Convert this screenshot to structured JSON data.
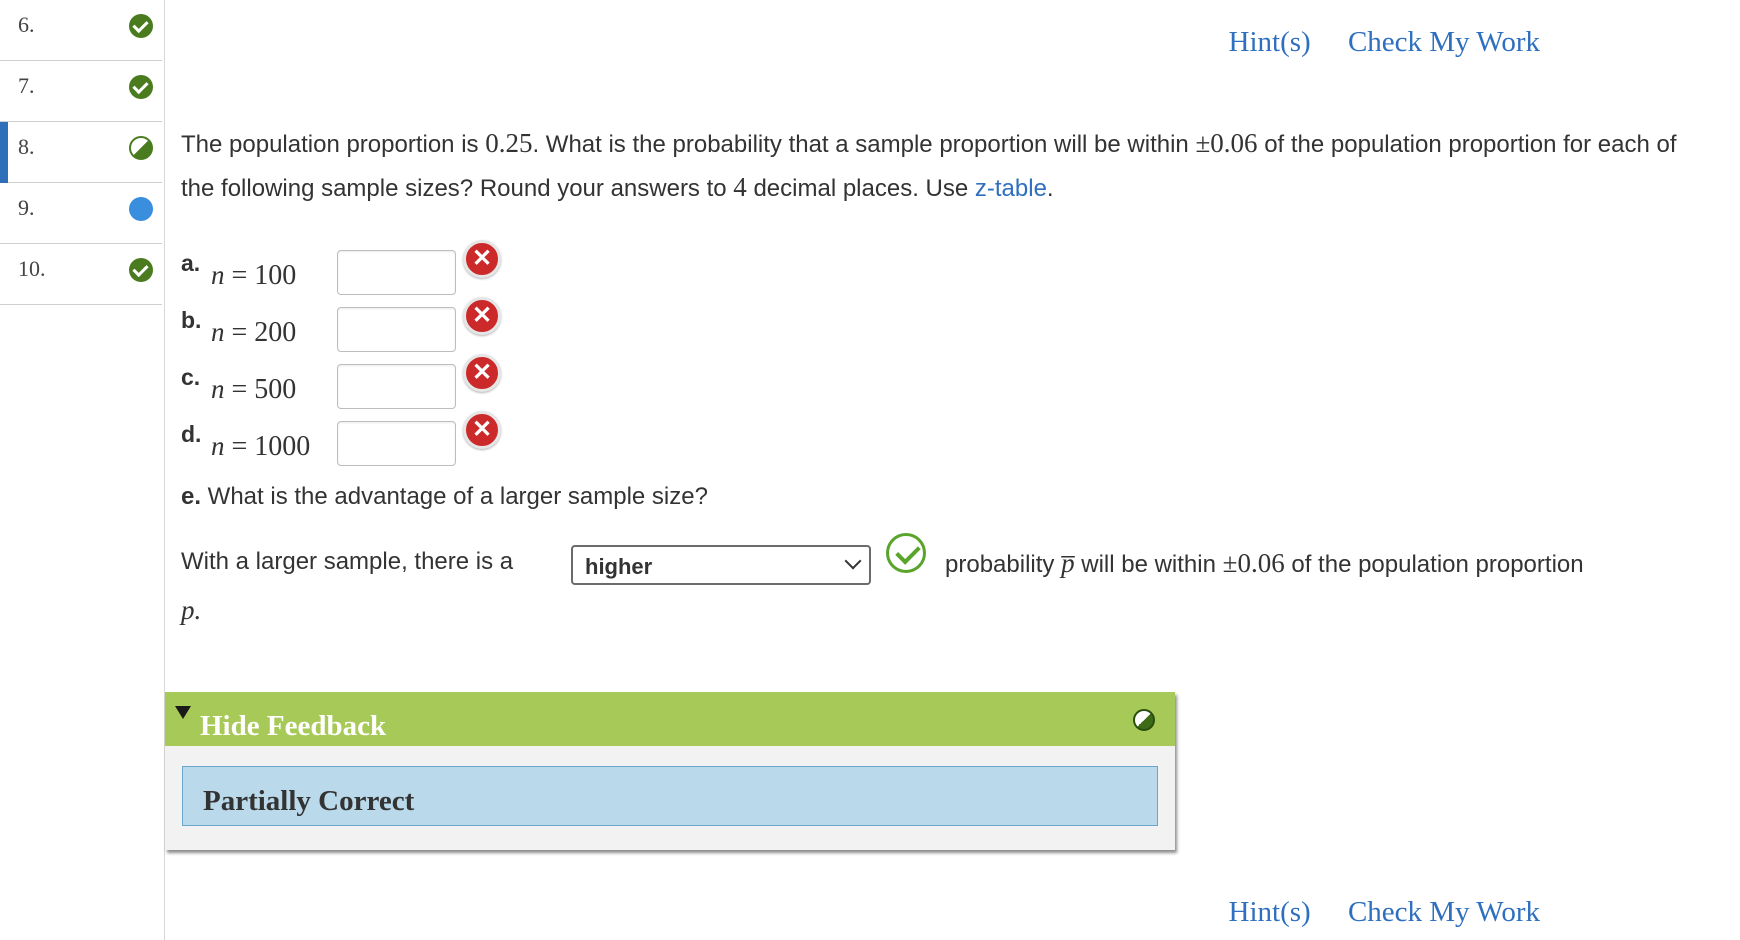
{
  "sidebar": {
    "items": [
      {
        "num": "6.",
        "status": "correct"
      },
      {
        "num": "7.",
        "status": "correct"
      },
      {
        "num": "8.",
        "status": "partial",
        "active": true
      },
      {
        "num": "9.",
        "status": "current"
      },
      {
        "num": "10.",
        "status": "correct"
      }
    ]
  },
  "links": {
    "hints": "Hint(s)",
    "check": "Check My Work"
  },
  "question": {
    "text1": "The population proportion is ",
    "p_value": "0.25",
    "text2": ". What is the probability that a sample proportion will be within ",
    "within": "±0.06",
    "text3": " of the population proportion for each of the following sample sizes? Round your answers to ",
    "decimals": "4",
    "text4": " decimal places. Use ",
    "table_link": "z-table",
    "text5": "."
  },
  "parts": [
    {
      "label": "a.",
      "n_symbol": "n",
      "eq": " = 100",
      "value": ""
    },
    {
      "label": "b.",
      "n_symbol": "n",
      "eq": " = 200",
      "value": ""
    },
    {
      "label": "c.",
      "n_symbol": "n",
      "eq": " = 500",
      "value": ""
    },
    {
      "label": "d.",
      "n_symbol": "n",
      "eq": " = 1000",
      "value": ""
    }
  ],
  "part_e": {
    "label": "e.",
    "question": " What is the advantage of a larger sample size?",
    "sentence_start": "With a larger sample, there is a",
    "selected": "higher",
    "sentence_mid": "probability ",
    "pbar": "p̅",
    "sentence_mid2": " will be within ",
    "within": "±0.06",
    "sentence_end": " of the population proportion",
    "p_end": "p."
  },
  "feedback": {
    "title": "Hide Feedback",
    "result": "Partially Correct"
  },
  "colors": {
    "link": "#2e6fbf",
    "feedback_header": "#a7c957",
    "feedback_body": "#bad9ea",
    "wrong": "#cc2a2a",
    "correct": "#59a52c"
  }
}
